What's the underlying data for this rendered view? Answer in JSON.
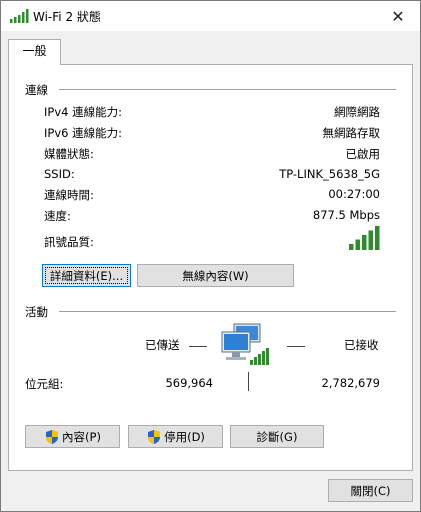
{
  "window": {
    "title": "Wi-Fi 2 狀態",
    "close_glyph": "✕"
  },
  "tab": {
    "label": "一般"
  },
  "connection": {
    "section_title": "連線",
    "rows": [
      {
        "label": "IPv4 連線能力:",
        "value": "網際網路"
      },
      {
        "label": "IPv6 連線能力:",
        "value": "無網路存取"
      },
      {
        "label": "媒體狀態:",
        "value": "已啟用"
      },
      {
        "label": "SSID:",
        "value": "TP-LINK_5638_5G"
      },
      {
        "label": "連線時間:",
        "value": "00:27:00"
      },
      {
        "label": "速度:",
        "value": "877.5 Mbps"
      }
    ],
    "signal_label": "訊號品質:",
    "signal_bars": 5,
    "signal_max": 5,
    "signal_color": "#2e8b2e",
    "details_button": "詳細資料(E)...",
    "wireless_props_button": "無線內容(W)"
  },
  "activity": {
    "section_title": "活動",
    "sent_label": "已傳送",
    "received_label": "已接收",
    "bytes_label": "位元組:",
    "bytes_sent": "569,964",
    "bytes_received": "2,782,679"
  },
  "actions": {
    "properties_button": "內容(P)",
    "disable_button": "停用(D)",
    "diagnose_button": "診斷(G)"
  },
  "footer": {
    "close_button": "關閉(C)"
  },
  "colors": {
    "focus_border": "#0078d7",
    "shield_blue": "#2a63c6",
    "shield_yellow": "#f5c400"
  }
}
